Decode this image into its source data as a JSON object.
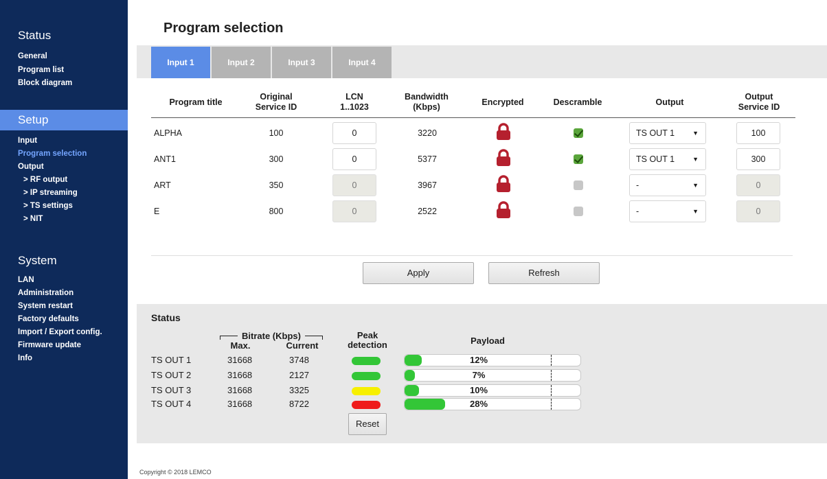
{
  "sidebar": {
    "status_title": "Status",
    "status_items": [
      "General",
      "Program list",
      "Block diagram"
    ],
    "setup_title": "Setup",
    "setup_items": [
      "Input",
      "Program selection",
      "Output",
      "> RF output",
      "> IP streaming",
      "> TS settings",
      "> NIT"
    ],
    "system_title": "System",
    "system_items": [
      "LAN",
      "Administration",
      "System restart",
      "Factory defaults",
      "Import / Export config.",
      "Firmware update",
      "Info"
    ],
    "active_color": "#74a5ff",
    "bg_color": "#0e2a5a",
    "accent_color": "#5b8ce6"
  },
  "page": {
    "title": "Program selection"
  },
  "tabs": [
    "Input 1",
    "Input 2",
    "Input 3",
    "Input 4"
  ],
  "table": {
    "headers": {
      "program_title": "Program title",
      "original_sid_1": "Original",
      "original_sid_2": "Service ID",
      "lcn_1": "LCN",
      "lcn_2": "1..1023",
      "bandwidth_1": "Bandwidth",
      "bandwidth_2": "(Kbps)",
      "encrypted": "Encrypted",
      "descramble": "Descramble",
      "output": "Output",
      "output_sid_1": "Output",
      "output_sid_2": "Service ID"
    },
    "rows": [
      {
        "title": "ALPHA",
        "sid": "100",
        "lcn": "0",
        "bandwidth": "3220",
        "encrypted": "lock-icon",
        "descramble": true,
        "output": "TS OUT 1",
        "out_sid": "100"
      },
      {
        "title": "ANT1",
        "sid": "300",
        "lcn": "0",
        "bandwidth": "5377",
        "encrypted": "lock-icon",
        "descramble": true,
        "output": "TS OUT 1",
        "out_sid": "300"
      },
      {
        "title": "ART",
        "sid": "350",
        "lcn": "0",
        "bandwidth": "3967",
        "encrypted": "lock-icon",
        "descramble": false,
        "output": "-",
        "out_sid": "0"
      },
      {
        "title": "E",
        "sid": "800",
        "lcn": "0",
        "bandwidth": "2522",
        "encrypted": "lock-icon",
        "descramble": false,
        "output": "-",
        "out_sid": "0"
      }
    ]
  },
  "buttons": {
    "apply": "Apply",
    "refresh": "Refresh",
    "reset": "Reset"
  },
  "status": {
    "title": "Status",
    "bitrate_label": "Bitrate (Kbps)",
    "max_label": "Max.",
    "current_label": "Current",
    "peak_label_1": "Peak",
    "peak_label_2": "detection",
    "payload_label": "Payload",
    "rows": [
      {
        "name": "TS OUT 1",
        "max": "31668",
        "current": "3748",
        "peak_color": "#33c637",
        "payload_pct": "12%",
        "payload_value": 12
      },
      {
        "name": "TS OUT 2",
        "max": "31668",
        "current": "2127",
        "peak_color": "#33c637",
        "payload_pct": "7%",
        "payload_value": 7
      },
      {
        "name": "TS OUT 3",
        "max": "31668",
        "current": "3325",
        "peak_color": "#f7f000",
        "payload_pct": "10%",
        "payload_value": 10
      },
      {
        "name": "TS OUT 4",
        "max": "31668",
        "current": "8722",
        "peak_color": "#ef1b1b",
        "payload_pct": "28%",
        "payload_value": 28
      }
    ]
  },
  "footer": {
    "copyright": "Copyright © 2018 LEMCO"
  }
}
